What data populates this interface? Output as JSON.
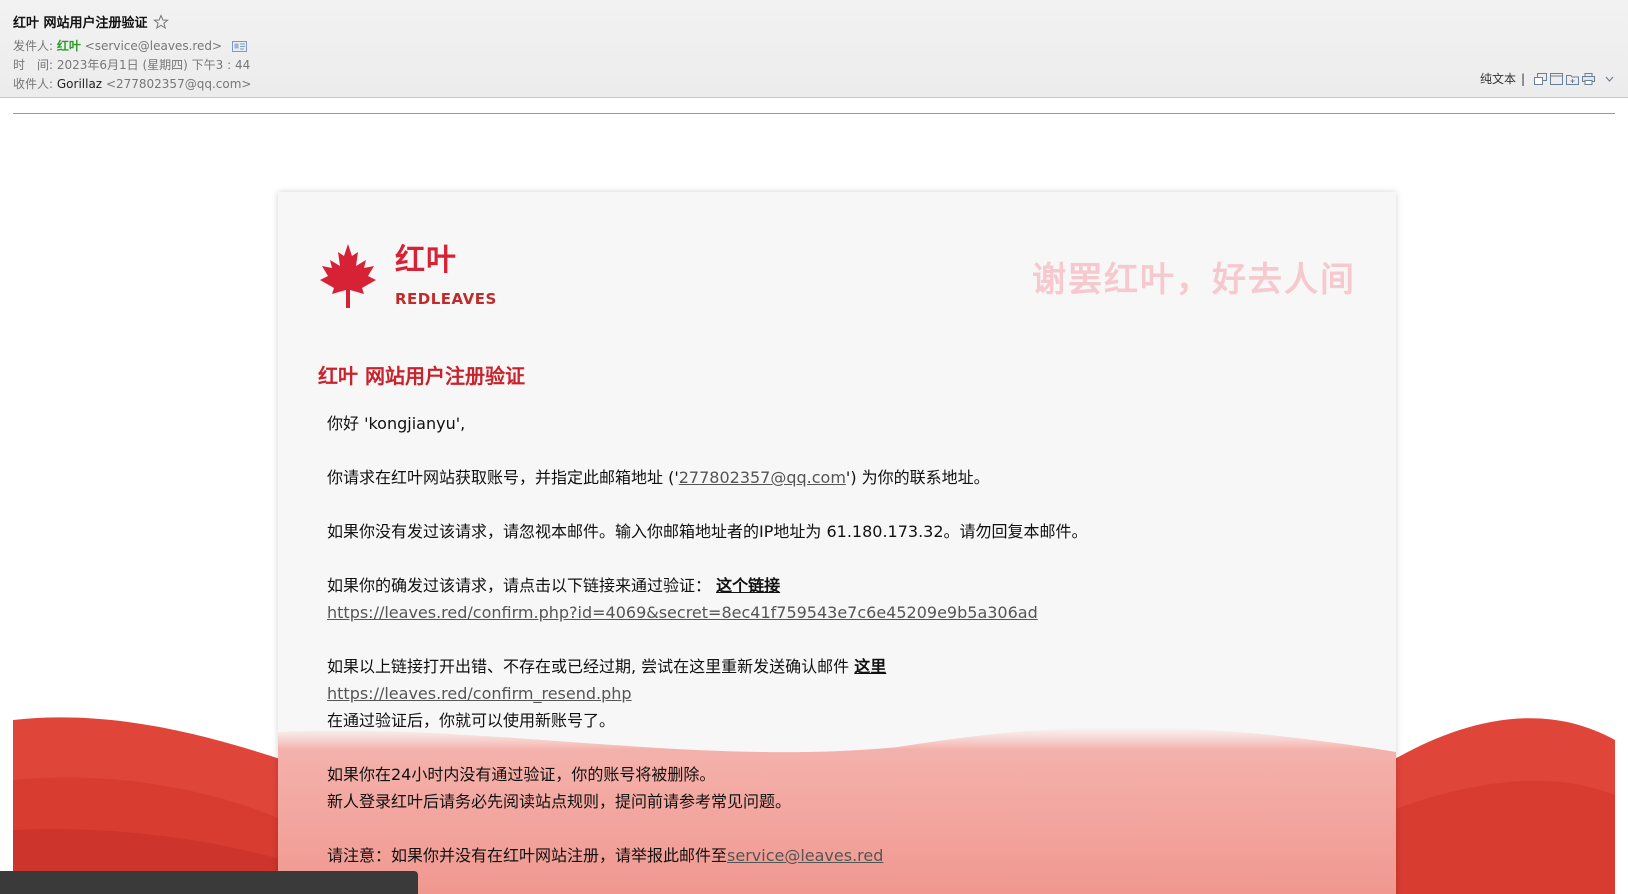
{
  "header": {
    "subject": "红叶 网站用户注册验证",
    "from_label": "发件人:",
    "from_name": "红叶",
    "from_addr": "<service@leaves.red>",
    "time_label": "时　间:",
    "time_value": "2023年6月1日 (星期四) 下午3 : 44",
    "to_label": "收件人:",
    "to_name": "Gorillaz",
    "to_addr": "<277802357@qq.com>",
    "plain_text_label": "纯文本",
    "toolbar_sep": "|"
  },
  "card": {
    "brand_cn": "红叶",
    "brand_en": "REDLEAVES",
    "slogan": "谢罢红叶，好去人间",
    "heading": "红叶 网站用户注册验证",
    "greeting": "你好 'kongjianyu',",
    "p1_a": "你请求在红叶网站获取账号，并指定此邮箱地址 ('",
    "p1_email": "277802357@qq.com",
    "p1_b": "') 为你的联系地址。",
    "p2": "如果你没有发过该请求，请忽视本邮件。输入你邮箱地址者的IP地址为 61.180.173.32。请勿回复本邮件。",
    "p3_a": "如果你的确发过该请求，请点击以下链接来通过验证：",
    "p3_link_text": "这个链接",
    "p3_url": "https://leaves.red/confirm.php?id=4069&secret=8ec41f759543e7c6e45209e9b5a306ad",
    "p4_a": "如果以上链接打开出错、不存在或已经过期, 尝试在这里重新发送确认邮件",
    "p4_link_text": "这里",
    "p4_url": "https://leaves.red/confirm_resend.php",
    "p4_b": "在通过验证后，你就可以使用新账号了。",
    "p5_a": "如果你在24小时内没有通过验证，你的账号将被删除。",
    "p5_b": "新人登录红叶后请务必先阅读站点规则，提问前请参考常见问题。",
    "p6_a": "请注意：如果你并没有在红叶网站注册，请举报此邮件至",
    "p6_email": "service@leaves.red"
  },
  "colors": {
    "brand_red": "#d62234",
    "heading_red": "#c8232c",
    "slogan_pink": "#f6c9cf",
    "wave_red": "#e0453a",
    "sender_green": "#2e9a2e"
  },
  "icons": [
    "star-icon",
    "contact-card-icon",
    "maple-leaf-icon",
    "window-icon",
    "new-window-icon",
    "folder-icon",
    "print-icon",
    "chevron-down-icon"
  ]
}
